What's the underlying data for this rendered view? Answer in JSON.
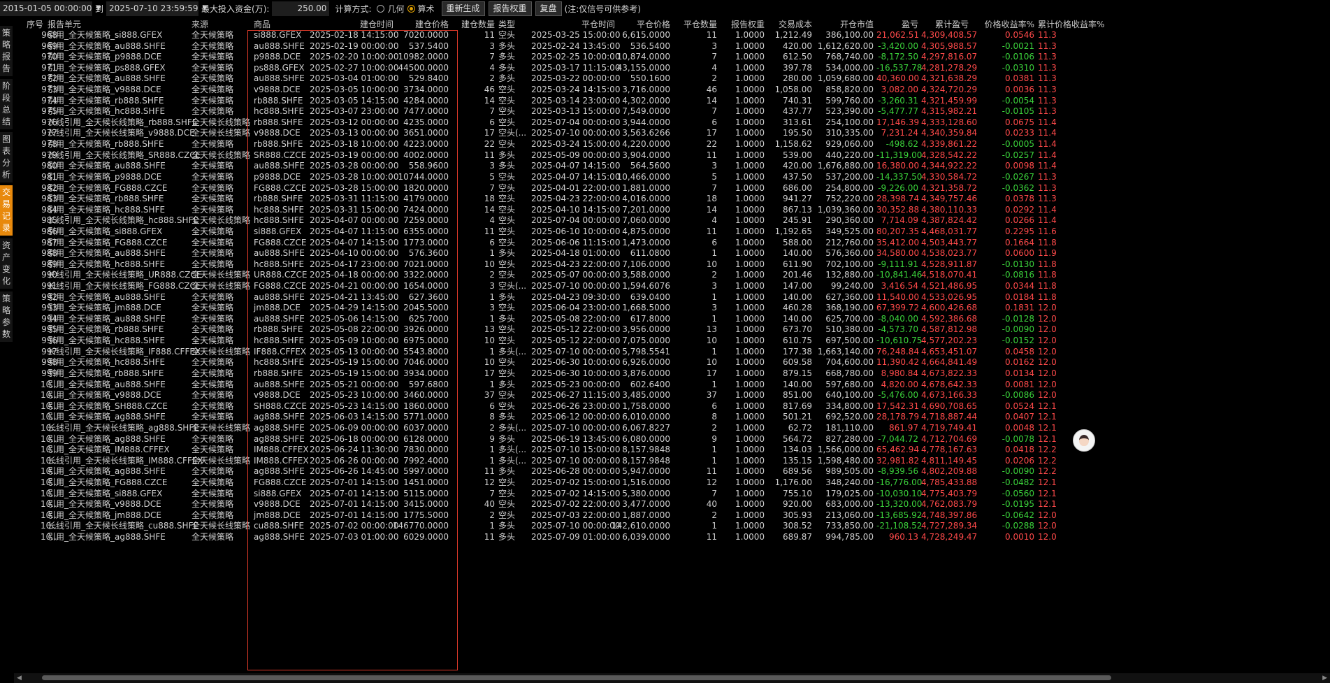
{
  "toolbar": {
    "start_date": "2015-01-05 00:00:00",
    "to_label": "到",
    "end_date": "2025-07-10 23:59:59",
    "max_capital_label": "最大投入资金(万):",
    "max_capital_value": "250.00",
    "calc_label": "计算方式:",
    "calc_option_geometric": "几何",
    "calc_option_arithmetic": "算术",
    "calc_selected": "算术",
    "regenerate_button": "重新生成",
    "report_weight_button": "报告权重",
    "replay_button": "复盘",
    "note": "(注:仅信号可供参考)"
  },
  "sidebar": {
    "items": [
      {
        "label": "策略报告",
        "active": false
      },
      {
        "label": "阶段总结",
        "active": false
      },
      {
        "label": "图表分析",
        "active": false
      },
      {
        "label": "交易记录",
        "active": true
      },
      {
        "label": "资产变化",
        "active": false
      },
      {
        "label": "策略参数",
        "active": false
      }
    ]
  },
  "table": {
    "columns": [
      "序号",
      "报告单元",
      "来源",
      "商品",
      "建仓时间",
      "建仓价格",
      "建仓数量",
      "类型",
      "平仓时间",
      "平仓价格",
      "平仓数量",
      "报告权重",
      "交易成本",
      "开仓市值",
      "盈亏",
      "累计盈亏",
      "价格收益率%",
      "累计价格收益率%"
    ],
    "rows": [
      [
        "968",
        "引用_全天候策略_si888.GFEX",
        "全天候策略",
        "si888.GFEX",
        "2025-02-18 14:15:00",
        "7020.0000",
        "11",
        "空头",
        "2025-03-25 15:00:00",
        "6,615.0000",
        "11",
        "1.0000",
        "1,212.49",
        "386,100.00",
        "21,062.51",
        "4,309,408.57",
        "0.0546",
        "11.3"
      ],
      [
        "969",
        "引用_全天候策略_au888.SHFE",
        "全天候策略",
        "au888.SHFE",
        "2025-02-19 00:00:00",
        "537.5400",
        "3",
        "多头",
        "2025-02-24 13:45:00",
        "536.5400",
        "3",
        "1.0000",
        "420.00",
        "1,612,620.00",
        "-3,420.00",
        "4,305,988.57",
        "-0.0021",
        "11.3"
      ],
      [
        "970",
        "引用_全天候策略_p9888.DCE",
        "全天候策略",
        "p9888.DCE",
        "2025-02-20 10:00:00",
        "10982.0000",
        "7",
        "多头",
        "2025-02-25 10:00:00",
        "10,874.0000",
        "7",
        "1.0000",
        "612.50",
        "768,740.00",
        "-8,172.50",
        "4,297,816.07",
        "-0.0106",
        "11.3"
      ],
      [
        "971",
        "引用_全天候策略_ps888.GFEX",
        "全天候策略",
        "ps888.GFEX",
        "2025-02-27 10:00:00",
        "44500.0000",
        "4",
        "多头",
        "2025-03-17 11:15:00",
        "43,155.0000",
        "4",
        "1.0000",
        "397.78",
        "534,000.00",
        "-16,537.78",
        "4,281,278.29",
        "-0.0310",
        "11.3"
      ],
      [
        "972",
        "引用_全天候策略_au888.SHFE",
        "全天候策略",
        "au888.SHFE",
        "2025-03-04 01:00:00",
        "529.8400",
        "2",
        "多头",
        "2025-03-22 00:00:00",
        "550.1600",
        "2",
        "1.0000",
        "280.00",
        "1,059,680.00",
        "40,360.00",
        "4,321,638.29",
        "0.0381",
        "11.3"
      ],
      [
        "973",
        "引用_全天候策略_v9888.DCE",
        "全天候策略",
        "v9888.DCE",
        "2025-03-05 10:00:00",
        "3734.0000",
        "46",
        "空头",
        "2025-03-24 14:15:00",
        "3,716.0000",
        "46",
        "1.0000",
        "1,058.00",
        "858,820.00",
        "3,082.00",
        "4,324,720.29",
        "0.0036",
        "11.3"
      ],
      [
        "974",
        "引用_全天候策略_rb888.SHFE",
        "全天候策略",
        "rb888.SHFE",
        "2025-03-05 14:15:00",
        "4284.0000",
        "14",
        "空头",
        "2025-03-14 23:00:00",
        "4,302.0000",
        "14",
        "1.0000",
        "740.31",
        "599,760.00",
        "-3,260.31",
        "4,321,459.99",
        "-0.0054",
        "11.3"
      ],
      [
        "975",
        "引用_全天候策略_hc888.SHFE",
        "全天候策略",
        "hc888.SHFE",
        "2025-03-07 23:00:00",
        "7477.0000",
        "7",
        "空头",
        "2025-03-13 15:00:00",
        "7,549.0000",
        "7",
        "1.0000",
        "437.77",
        "523,390.00",
        "-5,477.77",
        "4,315,982.21",
        "-0.0105",
        "11.3"
      ],
      [
        "976",
        "长线引用_全天候长线策略_rb888.SHFE",
        "全天候长线策略",
        "rb888.SHFE",
        "2025-03-12 00:00:00",
        "4235.0000",
        "6",
        "空头",
        "2025-07-04 00:00:00",
        "3,944.0000",
        "6",
        "1.0000",
        "313.61",
        "254,100.00",
        "17,146.39",
        "4,333,128.60",
        "0.0675",
        "11.4"
      ],
      [
        "977",
        "长线引用_全天候长线策略_v9888.DCE",
        "全天候长线策略",
        "v9888.DCE",
        "2025-03-13 00:00:00",
        "3651.0000",
        "17",
        "空头(...",
        "2025-07-10 00:00:00",
        "3,563.6266",
        "17",
        "1.0000",
        "195.50",
        "310,335.00",
        "7,231.24",
        "4,340,359.84",
        "0.0233",
        "11.4"
      ],
      [
        "978",
        "引用_全天候策略_rb888.SHFE",
        "全天候策略",
        "rb888.SHFE",
        "2025-03-18 10:00:00",
        "4223.0000",
        "22",
        "空头",
        "2025-03-24 15:00:00",
        "4,220.0000",
        "22",
        "1.0000",
        "1,158.62",
        "929,060.00",
        "-498.62",
        "4,339,861.22",
        "-0.0005",
        "11.4"
      ],
      [
        "979",
        "长线引用_全天候长线策略_SR888.CZCE",
        "全天候长线策略",
        "SR888.CZCE",
        "2025-03-19 00:00:00",
        "4002.0000",
        "11",
        "多头",
        "2025-05-09 00:00:00",
        "3,904.0000",
        "11",
        "1.0000",
        "539.00",
        "440,220.00",
        "-11,319.00",
        "4,328,542.22",
        "-0.0257",
        "11.4"
      ],
      [
        "980",
        "引用_全天候策略_au888.SHFE",
        "全天候策略",
        "au888.SHFE",
        "2025-03-28 00:00:00",
        "558.9600",
        "3",
        "多头",
        "2025-04-07 14:15:00",
        "564.5600",
        "3",
        "1.0000",
        "420.00",
        "1,676,880.00",
        "16,380.00",
        "4,344,922.22",
        "0.0098",
        "11.4"
      ],
      [
        "981",
        "引用_全天候策略_p9888.DCE",
        "全天候策略",
        "p9888.DCE",
        "2025-03-28 10:00:00",
        "10744.0000",
        "5",
        "空头",
        "2025-04-07 14:15:00",
        "10,466.0000",
        "5",
        "1.0000",
        "437.50",
        "537,200.00",
        "-14,337.50",
        "4,330,584.72",
        "-0.0267",
        "11.3"
      ],
      [
        "982",
        "引用_全天候策略_FG888.CZCE",
        "全天候策略",
        "FG888.CZCE",
        "2025-03-28 15:00:00",
        "1820.0000",
        "7",
        "空头",
        "2025-04-01 22:00:00",
        "1,881.0000",
        "7",
        "1.0000",
        "686.00",
        "254,800.00",
        "-9,226.00",
        "4,321,358.72",
        "-0.0362",
        "11.3"
      ],
      [
        "983",
        "引用_全天候策略_rb888.SHFE",
        "全天候策略",
        "rb888.SHFE",
        "2025-03-31 11:15:00",
        "4179.0000",
        "18",
        "空头",
        "2025-04-23 22:00:00",
        "4,016.0000",
        "18",
        "1.0000",
        "941.27",
        "752,220.00",
        "28,398.74",
        "4,349,757.46",
        "0.0378",
        "11.3"
      ],
      [
        "984",
        "引用_全天候策略_hc888.SHFE",
        "全天候策略",
        "hc888.SHFE",
        "2025-03-31 15:00:00",
        "7424.0000",
        "14",
        "空头",
        "2025-04-10 14:15:00",
        "7,201.0000",
        "14",
        "1.0000",
        "867.13",
        "1,039,360.00",
        "30,352.88",
        "4,380,110.33",
        "0.0292",
        "11.4"
      ],
      [
        "985",
        "长线引用_全天候长线策略_hc888.SHFE",
        "全天候长线策略",
        "hc888.SHFE",
        "2025-04-07 00:00:00",
        "7259.0000",
        "4",
        "空头",
        "2025-07-04 00:00:00",
        "7,060.0000",
        "4",
        "1.0000",
        "245.91",
        "290,360.00",
        "7,714.09",
        "4,387,824.42",
        "0.0266",
        "11.4"
      ],
      [
        "986",
        "引用_全天候策略_si888.GFEX",
        "全天候策略",
        "si888.GFEX",
        "2025-04-07 11:15:00",
        "6355.0000",
        "11",
        "空头",
        "2025-06-10 10:00:00",
        "4,875.0000",
        "11",
        "1.0000",
        "1,192.65",
        "349,525.00",
        "80,207.35",
        "4,468,031.77",
        "0.2295",
        "11.6"
      ],
      [
        "987",
        "引用_全天候策略_FG888.CZCE",
        "全天候策略",
        "FG888.CZCE",
        "2025-04-07 14:15:00",
        "1773.0000",
        "6",
        "空头",
        "2025-06-06 11:15:00",
        "1,473.0000",
        "6",
        "1.0000",
        "588.00",
        "212,760.00",
        "35,412.00",
        "4,503,443.77",
        "0.1664",
        "11.8"
      ],
      [
        "988",
        "引用_全天候策略_au888.SHFE",
        "全天候策略",
        "au888.SHFE",
        "2025-04-10 00:00:00",
        "576.3600",
        "1",
        "多头",
        "2025-04-18 01:00:00",
        "611.0800",
        "1",
        "1.0000",
        "140.00",
        "576,360.00",
        "34,580.00",
        "4,538,023.77",
        "0.0600",
        "11.9"
      ],
      [
        "989",
        "引用_全天候策略_hc888.SHFE",
        "全天候策略",
        "hc888.SHFE",
        "2025-04-17 23:00:00",
        "7021.0000",
        "10",
        "空头",
        "2025-04-23 22:00:00",
        "7,106.0000",
        "10",
        "1.0000",
        "611.90",
        "702,100.00",
        "-9,111.91",
        "4,528,911.87",
        "-0.0130",
        "11.8"
      ],
      [
        "990",
        "长线引用_全天候长线策略_UR888.CZCE",
        "全天候长线策略",
        "UR888.CZCE",
        "2025-04-18 00:00:00",
        "3322.0000",
        "2",
        "空头",
        "2025-05-07 00:00:00",
        "3,588.0000",
        "2",
        "1.0000",
        "201.46",
        "132,880.00",
        "-10,841.46",
        "4,518,070.41",
        "-0.0816",
        "11.8"
      ],
      [
        "991",
        "长线引用_全天候长线策略_FG888.CZCE",
        "全天候长线策略",
        "FG888.CZCE",
        "2025-04-21 00:00:00",
        "1654.0000",
        "3",
        "空头(...",
        "2025-07-10 00:00:00",
        "1,594.6076",
        "3",
        "1.0000",
        "147.00",
        "99,240.00",
        "3,416.54",
        "4,521,486.95",
        "0.0344",
        "11.8"
      ],
      [
        "992",
        "引用_全天候策略_au888.SHFE",
        "全天候策略",
        "au888.SHFE",
        "2025-04-21 13:45:00",
        "627.3600",
        "1",
        "多头",
        "2025-04-23 09:30:00",
        "639.0400",
        "1",
        "1.0000",
        "140.00",
        "627,360.00",
        "11,540.00",
        "4,533,026.95",
        "0.0184",
        "11.8"
      ],
      [
        "993",
        "引用_全天候策略_jm888.DCE",
        "全天候策略",
        "jm888.DCE",
        "2025-04-29 14:15:00",
        "2045.5000",
        "3",
        "空头",
        "2025-06-04 23:00:00",
        "1,668.5000",
        "3",
        "1.0000",
        "460.28",
        "368,190.00",
        "67,399.72",
        "4,600,426.68",
        "0.1831",
        "12.0"
      ],
      [
        "994",
        "引用_全天候策略_au888.SHFE",
        "全天候策略",
        "au888.SHFE",
        "2025-05-06 14:15:00",
        "625.7000",
        "1",
        "多头",
        "2025-05-08 22:00:00",
        "617.8000",
        "1",
        "1.0000",
        "140.00",
        "625,700.00",
        "-8,040.00",
        "4,592,386.68",
        "-0.0128",
        "12.0"
      ],
      [
        "995",
        "引用_全天候策略_rb888.SHFE",
        "全天候策略",
        "rb888.SHFE",
        "2025-05-08 22:00:00",
        "3926.0000",
        "13",
        "空头",
        "2025-05-12 22:00:00",
        "3,956.0000",
        "13",
        "1.0000",
        "673.70",
        "510,380.00",
        "-4,573.70",
        "4,587,812.98",
        "-0.0090",
        "12.0"
      ],
      [
        "996",
        "引用_全天候策略_hc888.SHFE",
        "全天候策略",
        "hc888.SHFE",
        "2025-05-09 10:00:00",
        "6975.0000",
        "10",
        "空头",
        "2025-05-12 22:00:00",
        "7,075.0000",
        "10",
        "1.0000",
        "610.75",
        "697,500.00",
        "-10,610.75",
        "4,577,202.23",
        "-0.0152",
        "12.0"
      ],
      [
        "997",
        "长线引用_全天候长线策略_IF888.CFFEX",
        "全天候长线策略",
        "IF888.CFFEX",
        "2025-05-13 00:00:00",
        "5543.8000",
        "1",
        "多头(...",
        "2025-07-10 00:00:00",
        "5,798.5541",
        "1",
        "1.0000",
        "177.38",
        "1,663,140.00",
        "76,248.84",
        "4,653,451.07",
        "0.0458",
        "12.0"
      ],
      [
        "998",
        "引用_全天候策略_hc888.SHFE",
        "全天候策略",
        "hc888.SHFE",
        "2025-05-19 15:00:00",
        "7046.0000",
        "10",
        "空头",
        "2025-06-30 10:00:00",
        "6,926.0000",
        "10",
        "1.0000",
        "609.58",
        "704,600.00",
        "11,390.42",
        "4,664,841.49",
        "0.0162",
        "12.0"
      ],
      [
        "999",
        "引用_全天候策略_rb888.SHFE",
        "全天候策略",
        "rb888.SHFE",
        "2025-05-19 15:00:00",
        "3934.0000",
        "17",
        "空头",
        "2025-06-30 10:00:00",
        "3,876.0000",
        "17",
        "1.0000",
        "879.15",
        "668,780.00",
        "8,980.84",
        "4,673,822.33",
        "0.0134",
        "12.0"
      ],
      [
        "10...",
        "引用_全天候策略_au888.SHFE",
        "全天候策略",
        "au888.SHFE",
        "2025-05-21 00:00:00",
        "597.6800",
        "1",
        "多头",
        "2025-05-23 00:00:00",
        "602.6400",
        "1",
        "1.0000",
        "140.00",
        "597,680.00",
        "4,820.00",
        "4,678,642.33",
        "0.0081",
        "12.0"
      ],
      [
        "10...",
        "引用_全天候策略_v9888.DCE",
        "全天候策略",
        "v9888.DCE",
        "2025-05-23 10:00:00",
        "3460.0000",
        "37",
        "空头",
        "2025-06-27 11:15:00",
        "3,485.0000",
        "37",
        "1.0000",
        "851.00",
        "640,100.00",
        "-5,476.00",
        "4,673,166.33",
        "-0.0086",
        "12.0"
      ],
      [
        "10...",
        "引用_全天候策略_SH888.CZCE",
        "全天候策略",
        "SH888.CZCE",
        "2025-05-23 14:15:00",
        "1860.0000",
        "6",
        "空头",
        "2025-06-26 23:00:00",
        "1,758.0000",
        "6",
        "1.0000",
        "817.69",
        "334,800.00",
        "17,542.31",
        "4,690,708.65",
        "0.0524",
        "12.1"
      ],
      [
        "10...",
        "引用_全天候策略_ag888.SHFE",
        "全天候策略",
        "ag888.SHFE",
        "2025-06-03 14:15:00",
        "5771.0000",
        "8",
        "多头",
        "2025-06-12 00:00:00",
        "6,010.0000",
        "8",
        "1.0000",
        "501.21",
        "692,520.00",
        "28,178.79",
        "4,718,887.44",
        "0.0407",
        "12.1"
      ],
      [
        "10...",
        "长线引用_全天候长线策略_ag888.SHFE",
        "全天候长线策略",
        "ag888.SHFE",
        "2025-06-09 00:00:00",
        "6037.0000",
        "2",
        "多头(...",
        "2025-07-10 00:00:00",
        "6,067.8227",
        "2",
        "1.0000",
        "62.72",
        "181,110.00",
        "861.97",
        "4,719,749.41",
        "0.0048",
        "12.1"
      ],
      [
        "10...",
        "引用_全天候策略_ag888.SHFE",
        "全天候策略",
        "ag888.SHFE",
        "2025-06-18 00:00:00",
        "6128.0000",
        "9",
        "多头",
        "2025-06-19 13:45:00",
        "6,080.0000",
        "9",
        "1.0000",
        "564.72",
        "827,280.00",
        "-7,044.72",
        "4,712,704.69",
        "-0.0078",
        "12.1"
      ],
      [
        "10...",
        "引用_全天候策略_IM888.CFFEX",
        "全天候策略",
        "IM888.CFFEX",
        "2025-06-24 11:30:00",
        "7830.0000",
        "1",
        "多头(...",
        "2025-07-10 15:00:00",
        "8,157.9848",
        "1",
        "1.0000",
        "134.03",
        "1,566,000.00",
        "65,462.94",
        "4,778,167.63",
        "0.0418",
        "12.2"
      ],
      [
        "10...",
        "长线引用_全天候长线策略_IM888.CFFEX",
        "全天候长线策略",
        "IM888.CFFEX",
        "2025-06-26 00:00:00",
        "7992.4000",
        "1",
        "多头(...",
        "2025-07-10 00:00:00",
        "8,157.9848",
        "1",
        "1.0000",
        "135.15",
        "1,598,480.00",
        "32,981.82",
        "4,811,149.45",
        "0.0206",
        "12.2"
      ],
      [
        "10...",
        "引用_全天候策略_ag888.SHFE",
        "全天候策略",
        "ag888.SHFE",
        "2025-06-26 14:45:00",
        "5997.0000",
        "11",
        "多头",
        "2025-06-28 00:00:00",
        "5,947.0000",
        "11",
        "1.0000",
        "689.56",
        "989,505.00",
        "-8,939.56",
        "4,802,209.88",
        "-0.0090",
        "12.2"
      ],
      [
        "10...",
        "引用_全天候策略_FG888.CZCE",
        "全天候策略",
        "FG888.CZCE",
        "2025-07-01 14:15:00",
        "1451.0000",
        "12",
        "空头",
        "2025-07-02 15:00:00",
        "1,516.0000",
        "12",
        "1.0000",
        "1,176.00",
        "348,240.00",
        "-16,776.00",
        "4,785,433.88",
        "-0.0482",
        "12.1"
      ],
      [
        "10...",
        "引用_全天候策略_si888.GFEX",
        "全天候策略",
        "si888.GFEX",
        "2025-07-01 14:15:00",
        "5115.0000",
        "7",
        "空头",
        "2025-07-02 14:15:00",
        "5,380.0000",
        "7",
        "1.0000",
        "755.10",
        "179,025.00",
        "-10,030.10",
        "4,775,403.79",
        "-0.0560",
        "12.1"
      ],
      [
        "10...",
        "引用_全天候策略_v9888.DCE",
        "全天候策略",
        "v9888.DCE",
        "2025-07-01 14:15:00",
        "3415.0000",
        "40",
        "空头",
        "2025-07-02 22:00:00",
        "3,477.0000",
        "40",
        "1.0000",
        "920.00",
        "683,000.00",
        "-13,320.00",
        "4,762,083.79",
        "-0.0195",
        "12.1"
      ],
      [
        "10...",
        "引用_全天候策略_jm888.DCE",
        "全天候策略",
        "jm888.DCE",
        "2025-07-01 14:15:00",
        "1775.5000",
        "2",
        "空头",
        "2025-07-03 22:00:00",
        "1,887.0000",
        "2",
        "1.0000",
        "305.93",
        "213,060.00",
        "-13,685.92",
        "4,748,397.86",
        "-0.0642",
        "12.0"
      ],
      [
        "10...",
        "长线引用_全天候长线策略_cu888.SHFE",
        "全天候长线策略",
        "cu888.SHFE",
        "2025-07-02 00:00:00",
        "146770.0000",
        "1",
        "多头",
        "2025-07-10 00:00:00",
        "142,610.0000",
        "1",
        "1.0000",
        "308.52",
        "733,850.00",
        "-21,108.52",
        "4,727,289.34",
        "-0.0288",
        "12.0"
      ],
      [
        "10...",
        "引用_全天候策略_ag888.SHFE",
        "全天候策略",
        "ag888.SHFE",
        "2025-07-03 01:00:00",
        "6029.0000",
        "11",
        "多头",
        "2025-07-09 01:00:00",
        "6,039.0000",
        "11",
        "1.0000",
        "689.87",
        "994,785.00",
        "960.13",
        "4,728,249.47",
        "0.0010",
        "12.0"
      ]
    ]
  },
  "colors": {
    "profit": "#ff4a4a",
    "loss": "#3bd23b",
    "accent": "#e8890c",
    "selection_box": "#e03a2a"
  },
  "icons": {
    "dropdown": "chevron-down-icon",
    "avatar": "assistant-avatar-icon",
    "scroll_left": "arrow-left-icon",
    "scroll_right": "arrow-right-icon"
  }
}
